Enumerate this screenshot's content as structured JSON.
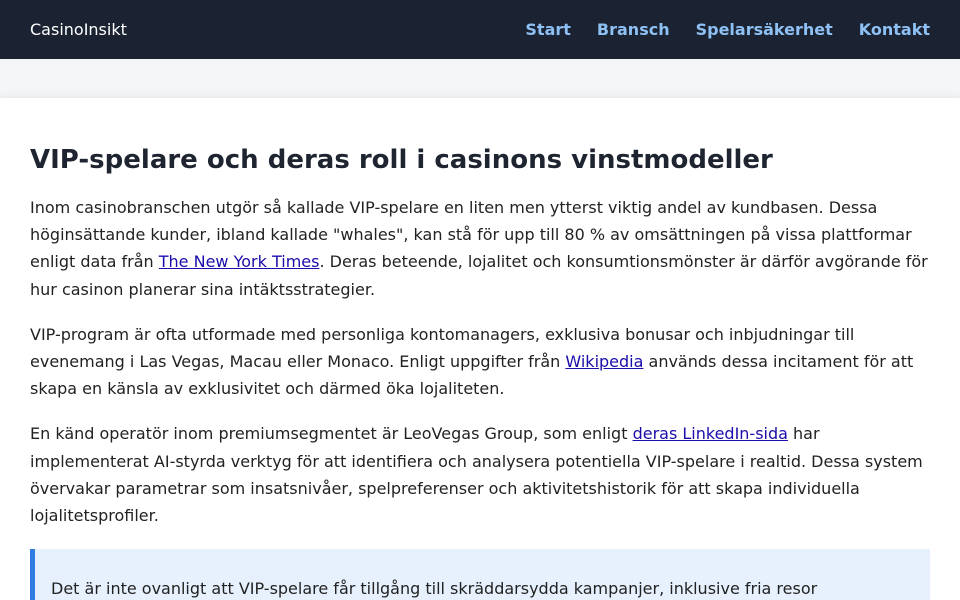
{
  "header": {
    "brand": "CasinoInsikt",
    "nav": [
      "Start",
      "Bransch",
      "Spelarsäkerhet",
      "Kontakt"
    ]
  },
  "article": {
    "title": "VIP-spelare och deras roll i casinons vinstmodeller",
    "p1": {
      "before": "Inom casinobranschen utgör så kallade VIP-spelare en liten men ytterst viktig andel av kundbasen. Dessa höginsättande kunder, ibland kallade \"whales\", kan stå för upp till 80 % av omsättningen på vissa plattformar enligt data från ",
      "link": "The New York Times",
      "after": ". Deras beteende, lojalitet och konsumtionsmönster är därför avgörande för hur casinon planerar sina intäktsstrategier."
    },
    "p2": {
      "before": "VIP-program är ofta utformade med personliga kontomanagers, exklusiva bonusar och inbjudningar till evenemang i Las Vegas, Macau eller Monaco. Enligt uppgifter från ",
      "link": "Wikipedia",
      "after": " används dessa incitament för att skapa en känsla av exklusivitet och därmed öka lojaliteten."
    },
    "p3": {
      "before": "En känd operatör inom premiumsegmentet är LeoVegas Group, som enligt ",
      "link": "deras LinkedIn-sida",
      "after": " har implementerat AI-styrda verktyg för att identifiera och analysera potentiella VIP-spelare i realtid. Dessa system övervakar parametrar som insatsnivåer, spelpreferenser och aktivitetshistorik för att skapa individuella lojalitetsprofiler."
    },
    "callout": "Det är inte ovanligt att VIP-spelare får tillgång till skräddarsydda kampanjer, inklusive fria resor"
  }
}
